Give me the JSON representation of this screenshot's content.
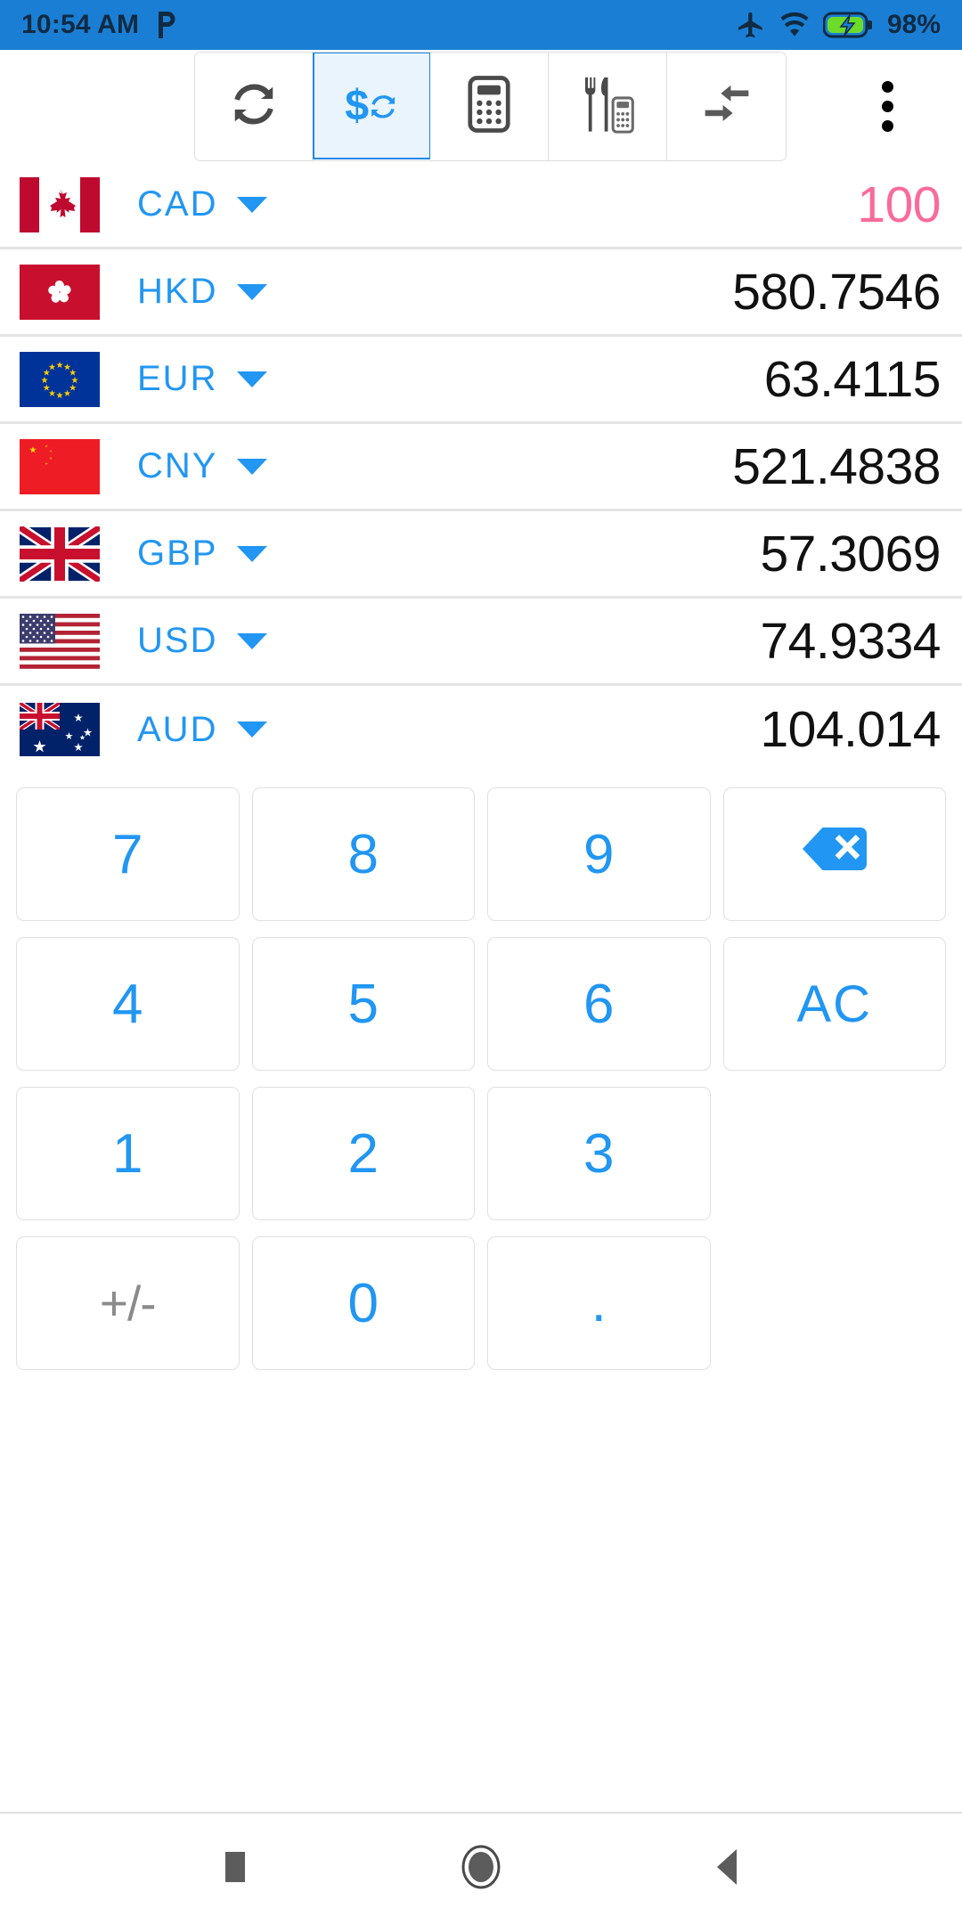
{
  "status_bar": {
    "time": "10:54 AM",
    "app_badge_icon": "pesa-p-icon",
    "icons": [
      "airplane-mode-icon",
      "wifi-icon",
      "battery-charging-icon"
    ],
    "battery_percent": "98%",
    "background_color": "#1a7fd4"
  },
  "toolbar": {
    "buttons": [
      {
        "name": "sync-rates",
        "icon": "refresh-sync-icon",
        "active": false
      },
      {
        "name": "currency-converter",
        "icon": "dollar-sync-icon",
        "active": true
      },
      {
        "name": "calculator",
        "icon": "calculator-icon",
        "active": false
      },
      {
        "name": "tip-calculator",
        "icon": "fork-knife-calculator-icon",
        "active": false
      },
      {
        "name": "compare",
        "icon": "converge-arrows-icon",
        "active": false
      }
    ],
    "overflow_menu_label": "More options",
    "active_color": "#1e88e5",
    "active_background": "#e9f4fd"
  },
  "currency_list": {
    "active_value_color": "#fa6a9b",
    "code_color": "#2196f3",
    "rows": [
      {
        "flag": "ca-flag",
        "code": "CAD",
        "value": "100",
        "active": true
      },
      {
        "flag": "hk-flag",
        "code": "HKD",
        "value": "580.7546",
        "active": false
      },
      {
        "flag": "eu-flag",
        "code": "EUR",
        "value": "63.4115",
        "active": false
      },
      {
        "flag": "cn-flag",
        "code": "CNY",
        "value": "521.4838",
        "active": false
      },
      {
        "flag": "gb-flag",
        "code": "GBP",
        "value": "57.3069",
        "active": false
      },
      {
        "flag": "us-flag",
        "code": "USD",
        "value": "74.9334",
        "active": false
      },
      {
        "flag": "au-flag",
        "code": "AUD",
        "value": "104.014",
        "active": false
      }
    ]
  },
  "keypad": {
    "keys": [
      {
        "name": "key-7",
        "label": "7",
        "type": "digit"
      },
      {
        "name": "key-8",
        "label": "8",
        "type": "digit"
      },
      {
        "name": "key-9",
        "label": "9",
        "type": "digit"
      },
      {
        "name": "key-backspace",
        "label": "",
        "type": "backspace",
        "icon": "backspace-icon"
      },
      {
        "name": "key-4",
        "label": "4",
        "type": "digit"
      },
      {
        "name": "key-5",
        "label": "5",
        "type": "digit"
      },
      {
        "name": "key-6",
        "label": "6",
        "type": "digit"
      },
      {
        "name": "key-all-clear",
        "label": "AC",
        "type": "ac"
      },
      {
        "name": "key-1",
        "label": "1",
        "type": "digit"
      },
      {
        "name": "key-2",
        "label": "2",
        "type": "digit"
      },
      {
        "name": "key-3",
        "label": "3",
        "type": "digit"
      },
      {
        "name": "key-blank-1",
        "label": "",
        "type": "blank"
      },
      {
        "name": "key-plus-minus",
        "label": "+/-",
        "type": "plusminus"
      },
      {
        "name": "key-0",
        "label": "0",
        "type": "digit"
      },
      {
        "name": "key-decimal",
        "label": ".",
        "type": "dot"
      },
      {
        "name": "key-blank-2",
        "label": "",
        "type": "blank"
      }
    ],
    "digit_color": "#2196f3",
    "plusminus_color": "#8a8a8a"
  },
  "navbar": {
    "buttons": [
      {
        "name": "recents-button",
        "icon": "square-icon"
      },
      {
        "name": "home-button",
        "icon": "circle-icon"
      },
      {
        "name": "back-button",
        "icon": "triangle-left-icon"
      }
    ]
  }
}
